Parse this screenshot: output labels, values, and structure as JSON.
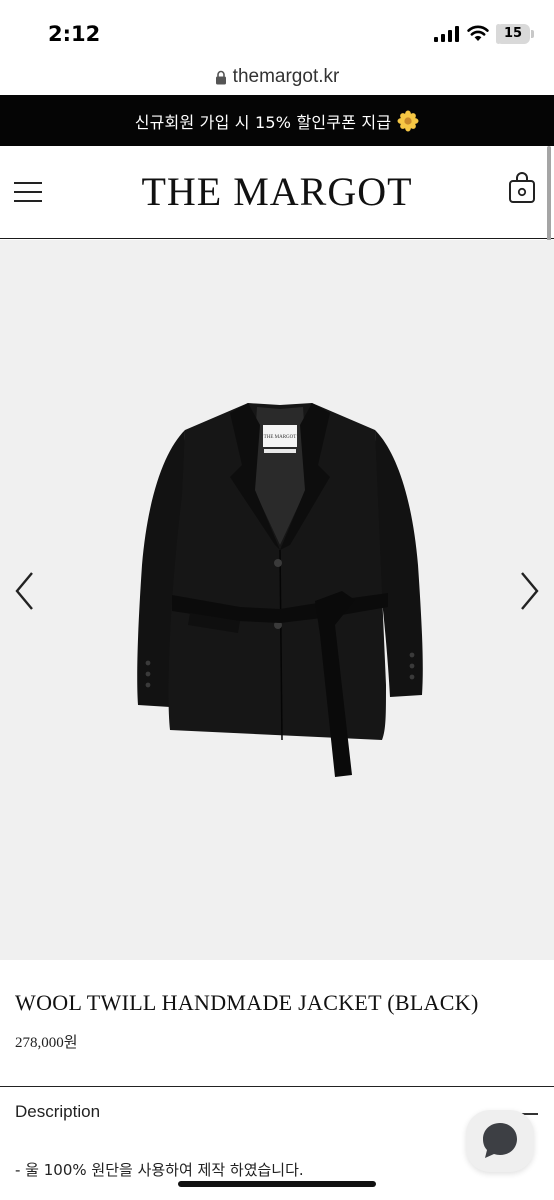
{
  "status_bar": {
    "time": "2:12",
    "battery": "15",
    "battery_fraction": 0.15,
    "icons": [
      "signal-icon",
      "wifi-icon",
      "battery-icon"
    ]
  },
  "browser": {
    "url": "themargot.kr",
    "lock_icon": "lock-icon"
  },
  "promo": {
    "text": "신규회원 가입 시 15% 할인쿠폰 지급",
    "icon": "flower-icon"
  },
  "header": {
    "logo": "THE MARGOT",
    "menu_icon": "hamburger-icon",
    "cart_icon": "shopping-bag-icon"
  },
  "product": {
    "name": "WOOL TWILL HANDMADE JACKET (BLACK)",
    "price": "278,000원",
    "image_icon": "black-jacket-image",
    "jacket_label": "THE MARGOT"
  },
  "description": {
    "title": "Description",
    "text": "- 울 100% 원단을 사용하여 제작 하였습니다."
  },
  "colors": {
    "banner_bg": "#050505",
    "image_bg": "#f0f0f0",
    "jacket": "#141414"
  }
}
